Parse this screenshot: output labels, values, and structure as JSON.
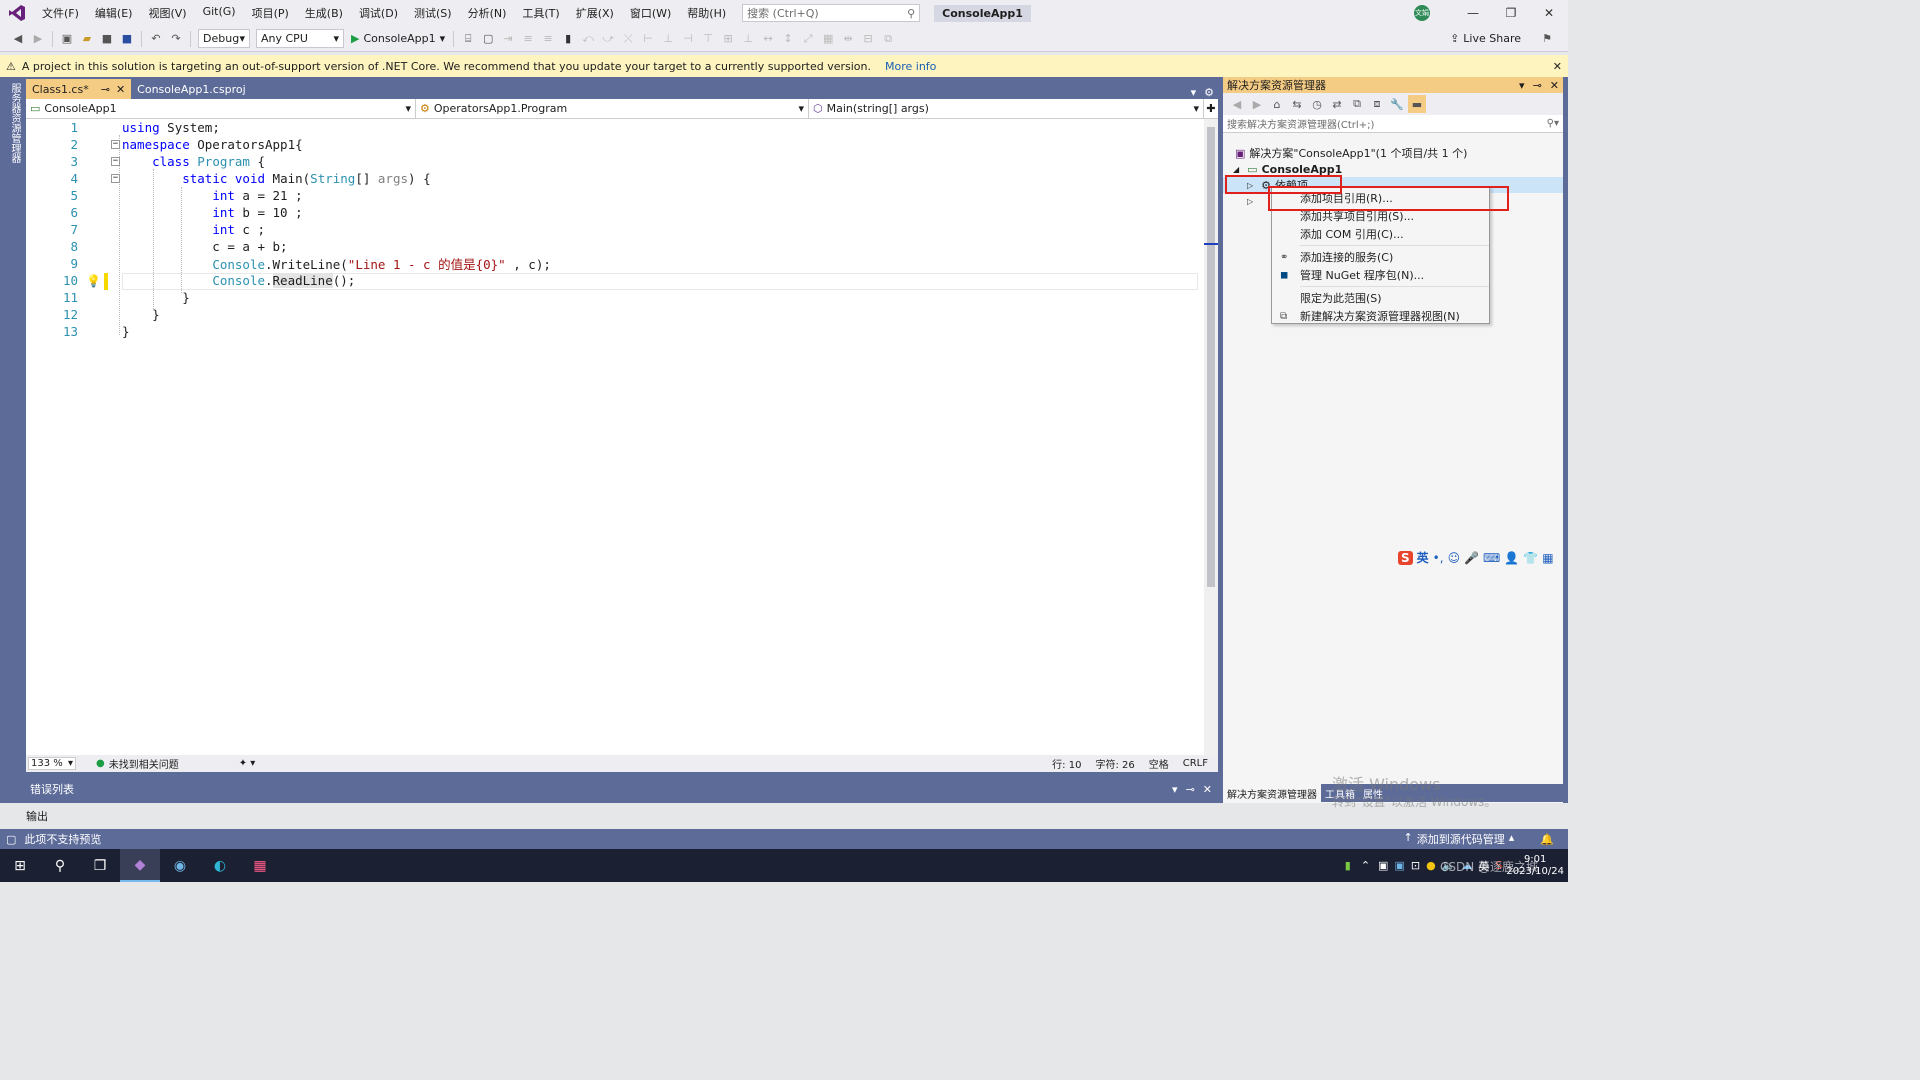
{
  "titlebar": {
    "menus": [
      "文件(F)",
      "编辑(E)",
      "视图(V)",
      "Git(G)",
      "项目(P)",
      "生成(B)",
      "调试(D)",
      "测试(S)",
      "分析(N)",
      "工具(T)",
      "扩展(X)",
      "窗口(W)",
      "帮助(H)"
    ],
    "search_placeholder": "搜索 (Ctrl+Q)",
    "app_title": "ConsoleApp1",
    "avatar_text": "文娟"
  },
  "toolbar": {
    "config": "Debug",
    "platform": "Any CPU",
    "run_label": "ConsoleApp1",
    "live_share": "Live Share"
  },
  "infobar": {
    "message": "A project in this solution is targeting an out-of-support version of .NET Core. We recommend that you update your target to a currently supported version.",
    "link": "More info"
  },
  "left_rail": {
    "label": "服务器资源管理器"
  },
  "editor": {
    "tabs": [
      {
        "label": "Class1.cs*",
        "active": true
      },
      {
        "label": "ConsoleApp1.csproj",
        "active": false
      }
    ],
    "nav": {
      "project": "ConsoleApp1",
      "type": "OperatorsApp1.Program",
      "member": "Main(string[] args)"
    },
    "line_numbers": [
      "1",
      "2",
      "3",
      "4",
      "5",
      "6",
      "7",
      "8",
      "9",
      "10",
      "11",
      "12",
      "13"
    ],
    "status": {
      "zoom": "133 %",
      "issues": "未找到相关问题",
      "line": "行: 10",
      "col": "字符: 26",
      "spaces": "空格",
      "eol": "CRLF"
    }
  },
  "panels": {
    "error_list": "错误列表",
    "output": "输出"
  },
  "solution_explorer": {
    "title": "解决方案资源管理器",
    "search_placeholder": "搜索解决方案资源管理器(Ctrl+;)",
    "solution_node": "解决方案\"ConsoleApp1\"(1 个项目/共 1 个)",
    "project_node": "ConsoleApp1",
    "deps_node": "依赖项",
    "bottom_tabs": [
      "解决方案资源管理器",
      "工具箱",
      "属性"
    ]
  },
  "context_menu": {
    "items": [
      "添加项目引用(R)...",
      "添加共享项目引用(S)...",
      "添加 COM 引用(C)...",
      "添加连接的服务(C)",
      "管理 NuGet 程序包(N)...",
      "限定为此范围(S)",
      "新建解决方案资源管理器视图(N)"
    ]
  },
  "statusbar": {
    "left": "此项不支持预览",
    "right": "添加到源代码管理"
  },
  "watermark": {
    "line1": "激活 Windows",
    "line2": "转到\"设置\"以激活 Windows。"
  },
  "ime": {
    "lang": "英"
  },
  "taskbar": {
    "time": "9:01",
    "date": "2023/10/24",
    "tray_lang": "英",
    "csdn": "CSDN @逐鹿之城"
  }
}
